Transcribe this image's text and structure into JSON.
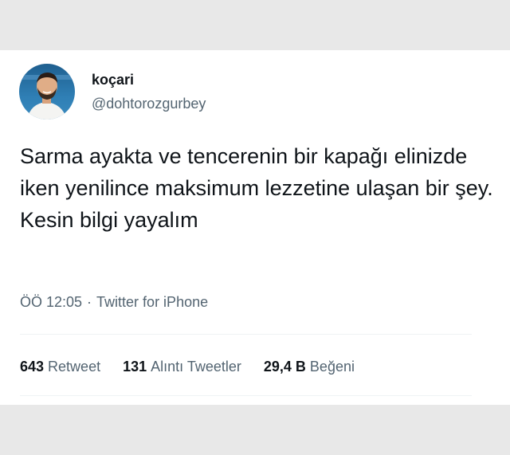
{
  "tweet": {
    "display_name": "koçari",
    "handle": "@dohtorozgurbey",
    "text": "Sarma ayakta ve tencerenin bir kapağı elinizde iken yenilince maksimum lezzetine ulaşan bir şey. Kesin bilgi yayalım",
    "time": "ÖÖ 12:05",
    "separator": "·",
    "source": "Twitter for iPhone",
    "stats": {
      "retweets": {
        "count": "643",
        "label": "Retweet"
      },
      "quotes": {
        "count": "131",
        "label": "Alıntı Tweetler"
      },
      "likes": {
        "count": "29,4 B",
        "label": "Beğeni"
      }
    }
  },
  "colors": {
    "background": "#e8e8e8",
    "card": "#ffffff",
    "primary_text": "#0f1419",
    "secondary_text": "#536471",
    "divider": "#eff3f4"
  }
}
